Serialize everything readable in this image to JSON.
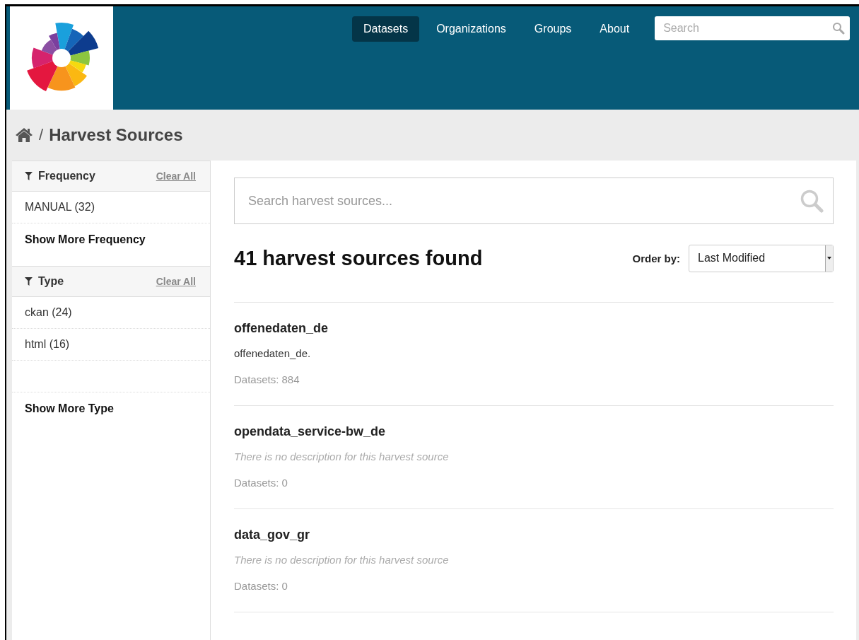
{
  "nav": {
    "items": [
      {
        "label": "Datasets",
        "selected": true
      },
      {
        "label": "Organizations",
        "selected": false
      },
      {
        "label": "Groups",
        "selected": false
      },
      {
        "label": "About",
        "selected": false
      }
    ],
    "search": {
      "placeholder": "Search"
    }
  },
  "breadcrumb": {
    "separator": "/",
    "current": "Harvest Sources"
  },
  "facets": [
    {
      "title": "Frequency",
      "clear": "Clear All",
      "items": [
        {
          "kind": "entry",
          "label": "MANUAL (32)"
        }
      ],
      "more": "Show More Frequency"
    },
    {
      "title": "Type",
      "clear": "Clear All",
      "items": [
        {
          "kind": "entry",
          "label": "ckan (24)"
        },
        {
          "kind": "entry",
          "label": "html (16)"
        },
        {
          "kind": "blank"
        }
      ],
      "more": "Show More Type"
    }
  ],
  "search": {
    "placeholder": "Search harvest sources..."
  },
  "results": {
    "heading": "41 harvest sources found",
    "order_label": "Order by:",
    "order_value": "Last Modified"
  },
  "sources": [
    {
      "title": "offenedaten_de",
      "description": "offenedaten_de.",
      "has_description": true,
      "datasets": "Datasets: 884"
    },
    {
      "title": "opendata_service-bw_de",
      "description": "There is no description for this harvest source",
      "has_description": false,
      "datasets": "Datasets: 0"
    },
    {
      "title": "data_gov_gr",
      "description": "There is no description for this harvest source",
      "has_description": false,
      "datasets": "Datasets: 0"
    }
  ]
}
